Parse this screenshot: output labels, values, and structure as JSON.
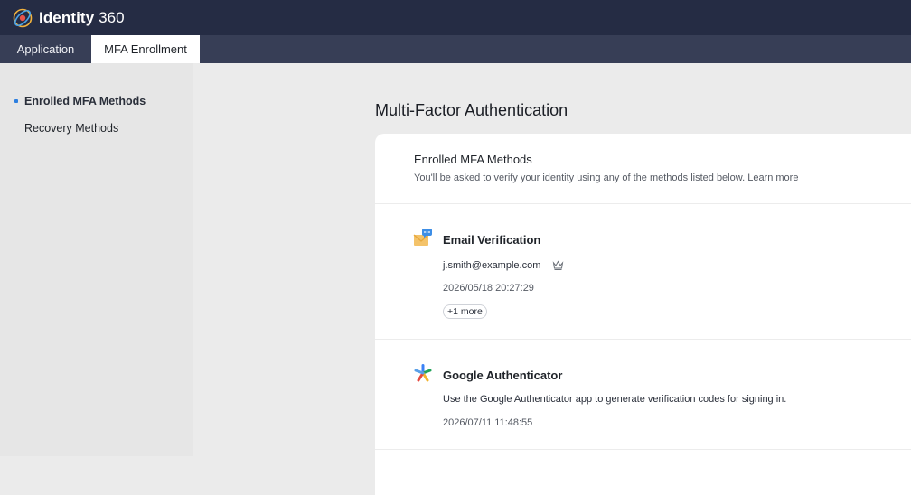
{
  "brand": {
    "name_bold": "Identity",
    "name_light": " 360"
  },
  "tabs": [
    {
      "label": "Application"
    },
    {
      "label": "MFA Enrollment"
    }
  ],
  "sidebar": {
    "items": [
      {
        "label": "Enrolled MFA Methods"
      },
      {
        "label": "Recovery Methods"
      }
    ]
  },
  "main": {
    "title": "Multi-Factor Authentication",
    "card": {
      "heading": "Enrolled MFA Methods",
      "subtitle": "You'll be asked to verify your identity using any of the methods listed below.",
      "learn_more": "Learn more",
      "methods": [
        {
          "icon": "email-icon",
          "title": "Email Verification",
          "email": "j.smith@example.com",
          "primary_icon": "crown-icon",
          "timestamp": "2026/05/18 20:27:29",
          "more": "+1 more"
        },
        {
          "icon": "google-authenticator-icon",
          "title": "Google Authenticator",
          "description": "Use the Google Authenticator app to generate verification codes for signing in.",
          "timestamp": "2026/07/11 11:48:55"
        }
      ]
    }
  },
  "colors": {
    "topbar": "#252c44",
    "tabbar": "#373e56",
    "accent": "#2d7fe0"
  }
}
